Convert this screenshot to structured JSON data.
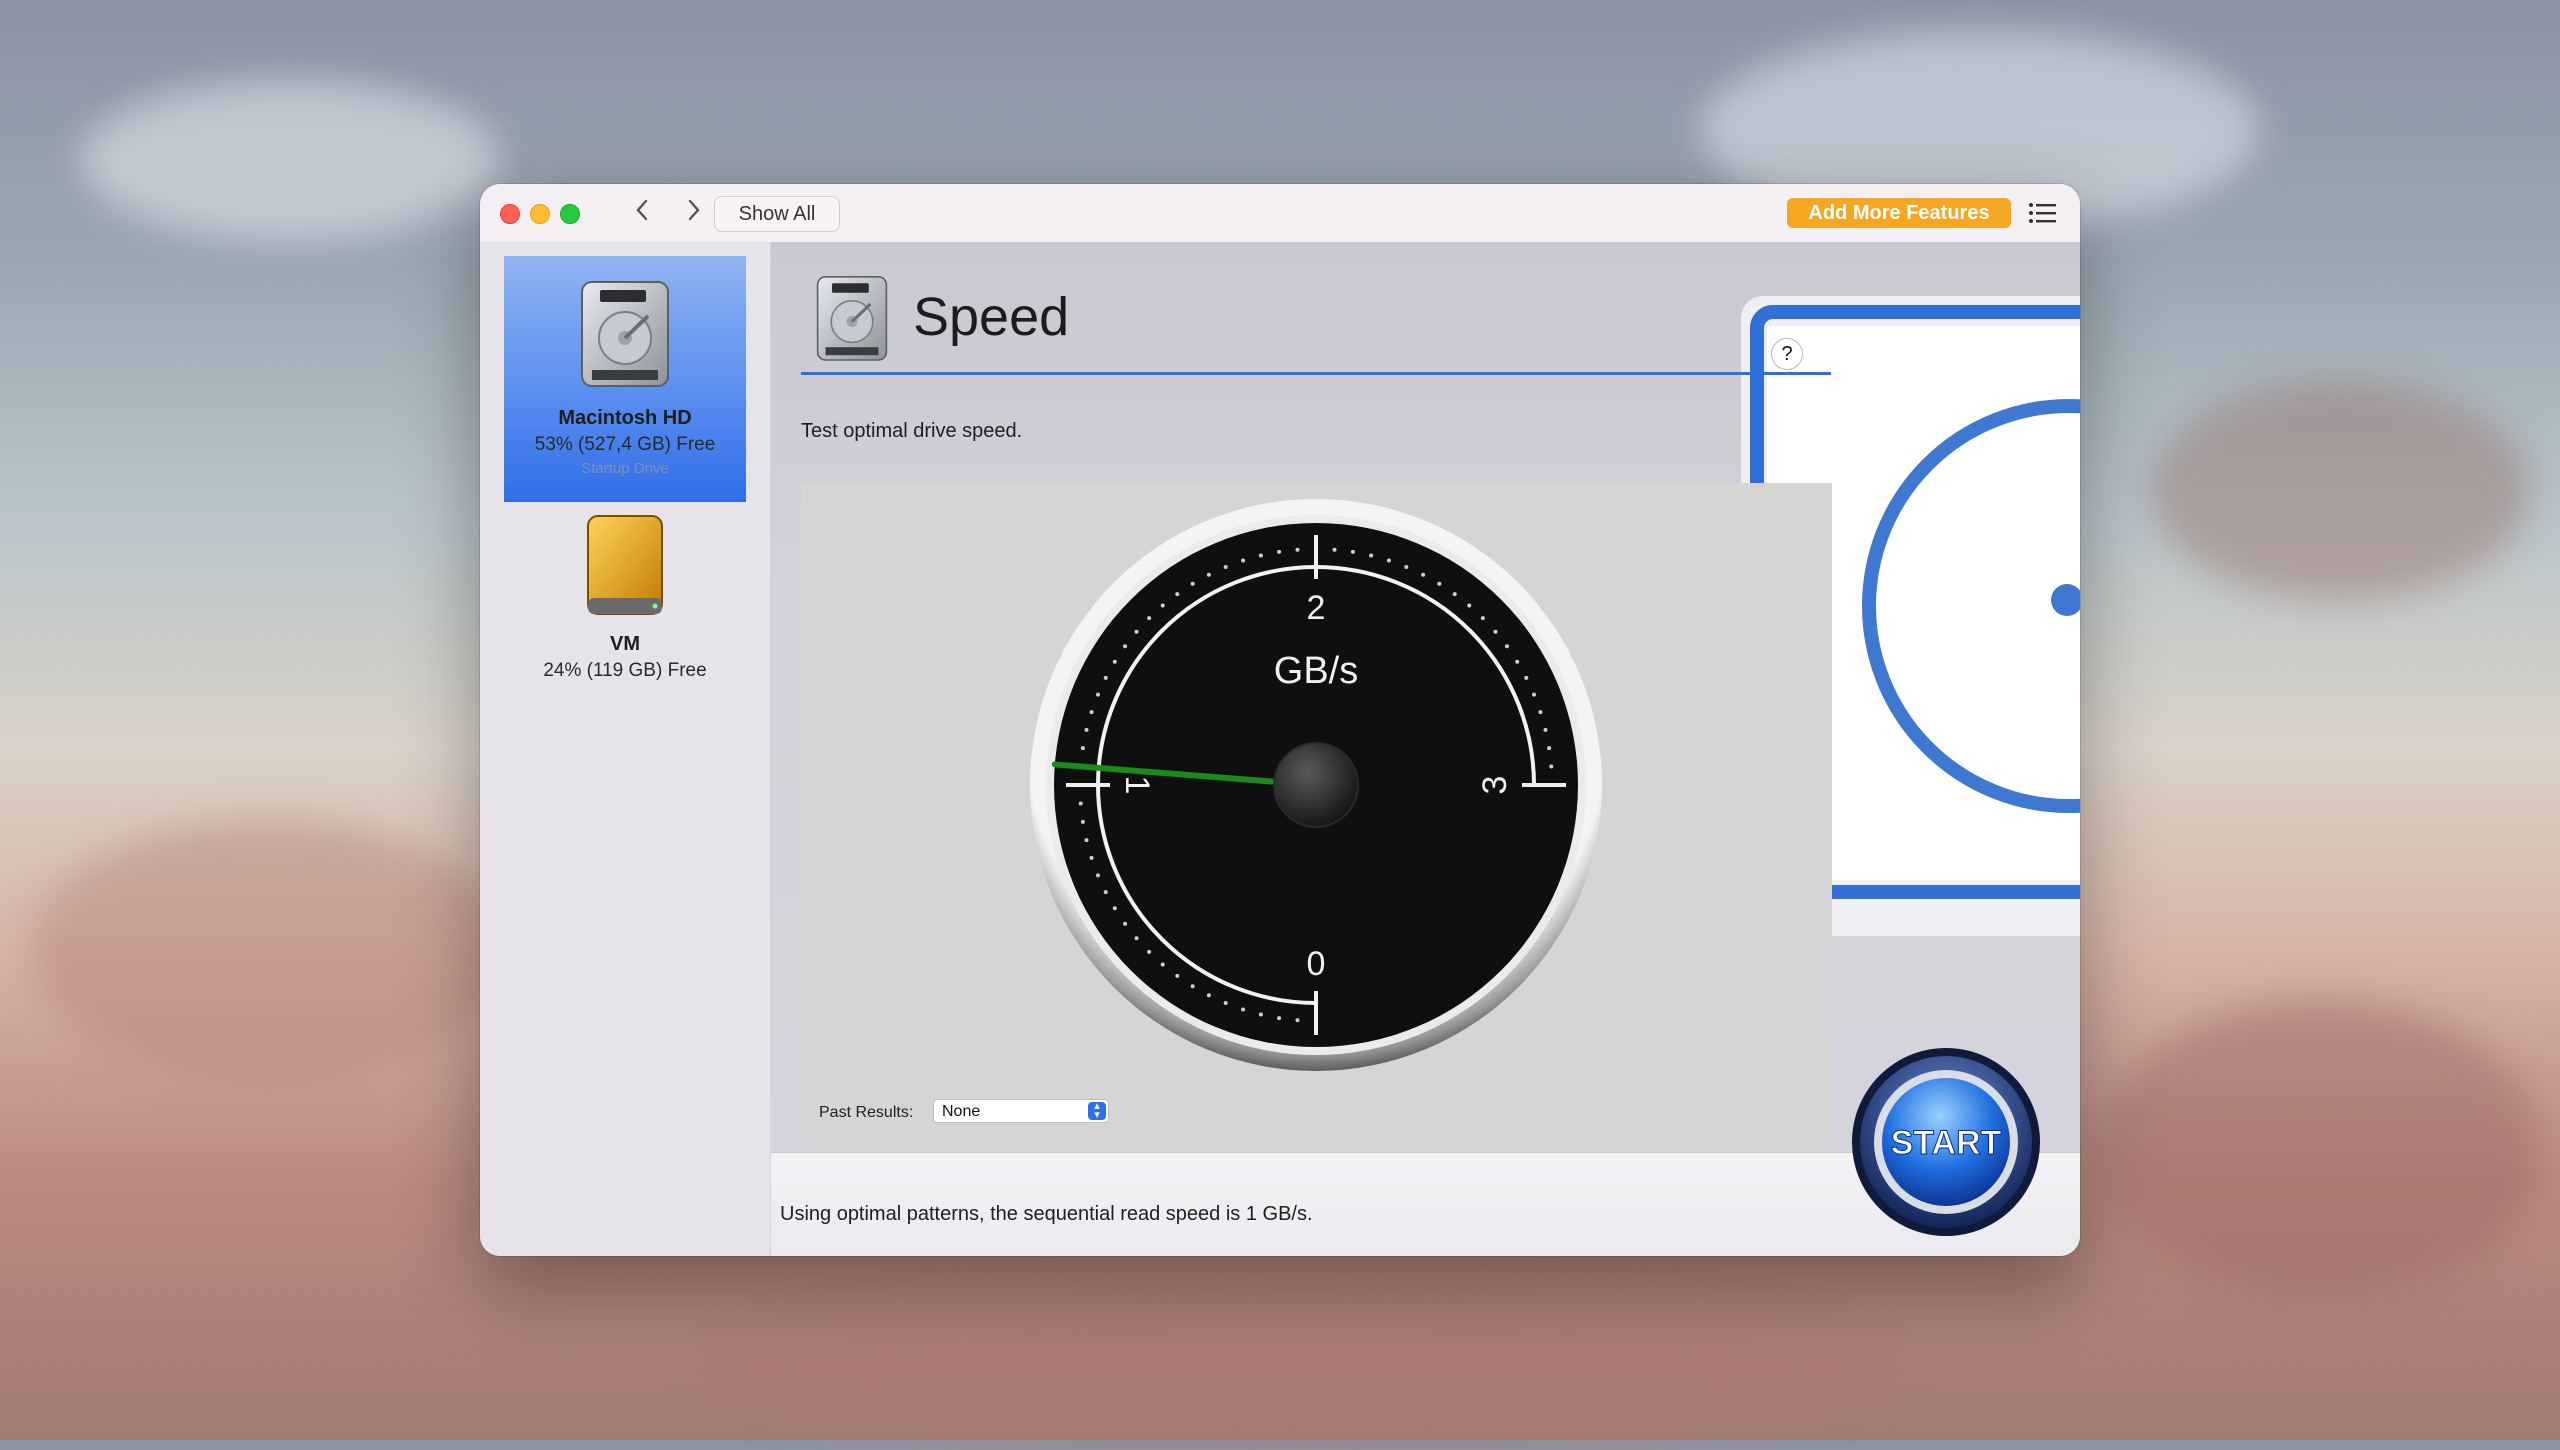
{
  "window": {
    "show_all_label": "Show All",
    "add_features_label": "Add More Features"
  },
  "sidebar": {
    "drives": [
      {
        "name": "Macintosh HD",
        "free": "53% (527,4 GB) Free",
        "subtitle": "Startup Drive",
        "selected": true,
        "icon": "hard-drive-icon"
      },
      {
        "name": "VM",
        "free": "24% (119 GB) Free",
        "subtitle": "",
        "selected": false,
        "icon": "external-drive-icon"
      }
    ]
  },
  "main": {
    "title": "Speed",
    "subtitle": "Test optimal drive speed.",
    "help_label": "?",
    "past_results_label": "Past Results:",
    "past_results_value": "None",
    "status_text": "Using optimal patterns, the sequential read speed is 1 GB/s.",
    "start_label": "START"
  },
  "gauge": {
    "unit": "GB/s",
    "tick_labels": [
      "0",
      "1",
      "2",
      "3"
    ],
    "min": 0,
    "max": 3,
    "value": 1.05,
    "needle_color": "#1a8a1a"
  },
  "colors": {
    "accent": "#2f6fd6",
    "add_features": "#f5a623",
    "selected_gradient_top": "#8fb4f0",
    "selected_gradient_bottom": "#2f6ee8"
  }
}
